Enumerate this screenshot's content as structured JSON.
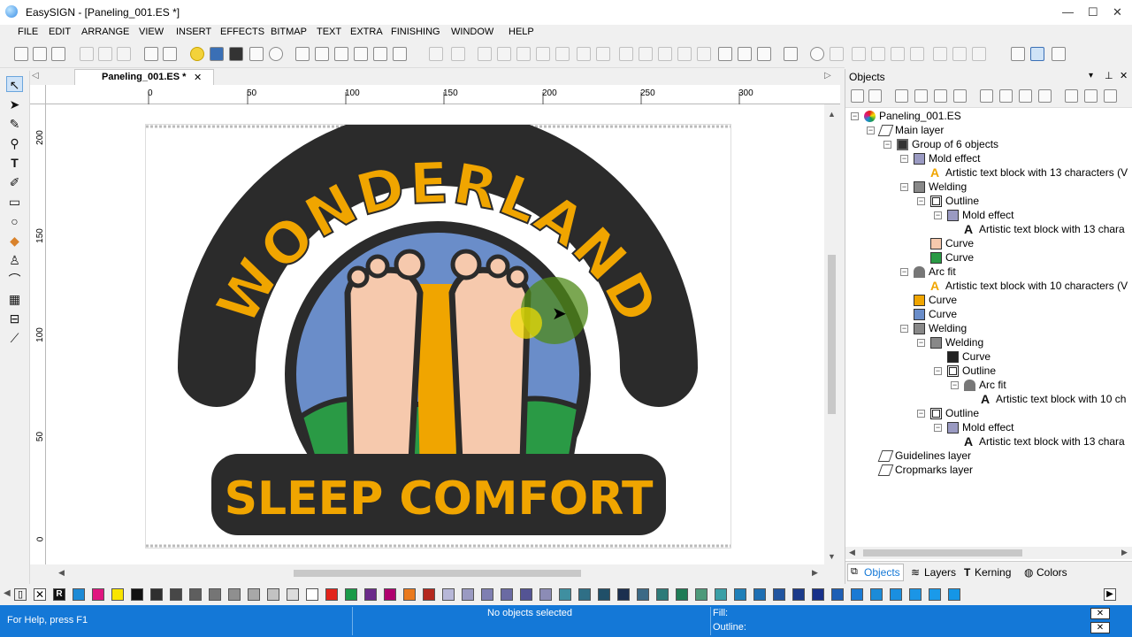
{
  "window": {
    "title": "EasySIGN - [Paneling_001.ES *]",
    "minimize": "—",
    "maximize": "☐",
    "close": "✕"
  },
  "menu": [
    "FILE",
    "EDIT",
    "ARRANGE",
    "VIEW",
    "INSERT",
    "EFFECTS",
    "BITMAP",
    "TEXT",
    "EXTRA",
    "FINISHING",
    "WINDOW",
    "HELP"
  ],
  "document_tab": {
    "label": "Paneling_001.ES *",
    "close": "✕"
  },
  "ruler": {
    "h_ticks": [
      "0",
      "50",
      "100",
      "150",
      "200",
      "250",
      "300"
    ],
    "v_ticks": [
      "200",
      "150",
      "100",
      "50",
      "0"
    ]
  },
  "artwork": {
    "arc_text": "WONDERLAND",
    "bottom_text": "SLEEP COMFORT"
  },
  "panel": {
    "title": "Objects",
    "tree": [
      {
        "label": "Paneling_001.ES"
      },
      {
        "label": "Main layer"
      },
      {
        "label": "Group of 6 objects"
      },
      {
        "label": "Mold effect"
      },
      {
        "label": "Artistic text block with 13 characters (V"
      },
      {
        "label": "Welding"
      },
      {
        "label": "Outline"
      },
      {
        "label": "Mold effect"
      },
      {
        "label": "Artistic text block with 13 chara"
      },
      {
        "label": "Curve"
      },
      {
        "label": "Curve"
      },
      {
        "label": "Arc fit"
      },
      {
        "label": "Artistic text block with 10 characters (V"
      },
      {
        "label": "Curve"
      },
      {
        "label": "Curve"
      },
      {
        "label": "Welding"
      },
      {
        "label": "Welding"
      },
      {
        "label": "Curve"
      },
      {
        "label": "Outline"
      },
      {
        "label": "Arc fit"
      },
      {
        "label": "Artistic text block with 10 ch"
      },
      {
        "label": "Outline"
      },
      {
        "label": "Mold effect"
      },
      {
        "label": "Artistic text block with 13 chara"
      },
      {
        "label": "Guidelines layer"
      },
      {
        "label": "Cropmarks layer"
      }
    ],
    "tabs": [
      "Objects",
      "Layers",
      "Kerning",
      "Colors"
    ]
  },
  "status": {
    "help": "For Help, press F1",
    "selection": "No objects selected",
    "fill": "Fill:",
    "outline": "Outline:"
  },
  "colors": {
    "accent": "#1478d7",
    "art_orange": "#f0a500",
    "art_dark": "#2b2b2b",
    "art_blue": "#6a8dc9",
    "art_green": "#2a9a45",
    "art_skin": "#f6c9ad"
  },
  "palette": [
    "#1c8ad6",
    "#e0157f",
    "#f9e400",
    "#111111",
    "#2f2f2f",
    "#474747",
    "#5e5e5e",
    "#757575",
    "#8f8f8f",
    "#a8a8a8",
    "#c2c2c2",
    "#dcdcdc",
    "#ffffff",
    "#e2231a",
    "#1a9a48",
    "#6b2a8a",
    "#b0006e",
    "#ea7a1e",
    "#b4281e",
    "#b7b7d8",
    "#9a9ac2",
    "#7f7fb2",
    "#6a6aa3",
    "#545494",
    "#8c8cb6",
    "#3f8fa0",
    "#2f6f86",
    "#204f68",
    "#1b2f4f",
    "#3c6a86",
    "#2e7b79",
    "#1e7b55",
    "#4d9a7a",
    "#3a9fa6",
    "#1f7fb8",
    "#1e6fb3",
    "#2155a0",
    "#1b3a8a",
    "#17308a",
    "#1e5fb5",
    "#1a7ad4",
    "#1b8bd8",
    "#1a8fe0",
    "#1b95e6",
    "#1a9aea",
    "#1596e6"
  ]
}
